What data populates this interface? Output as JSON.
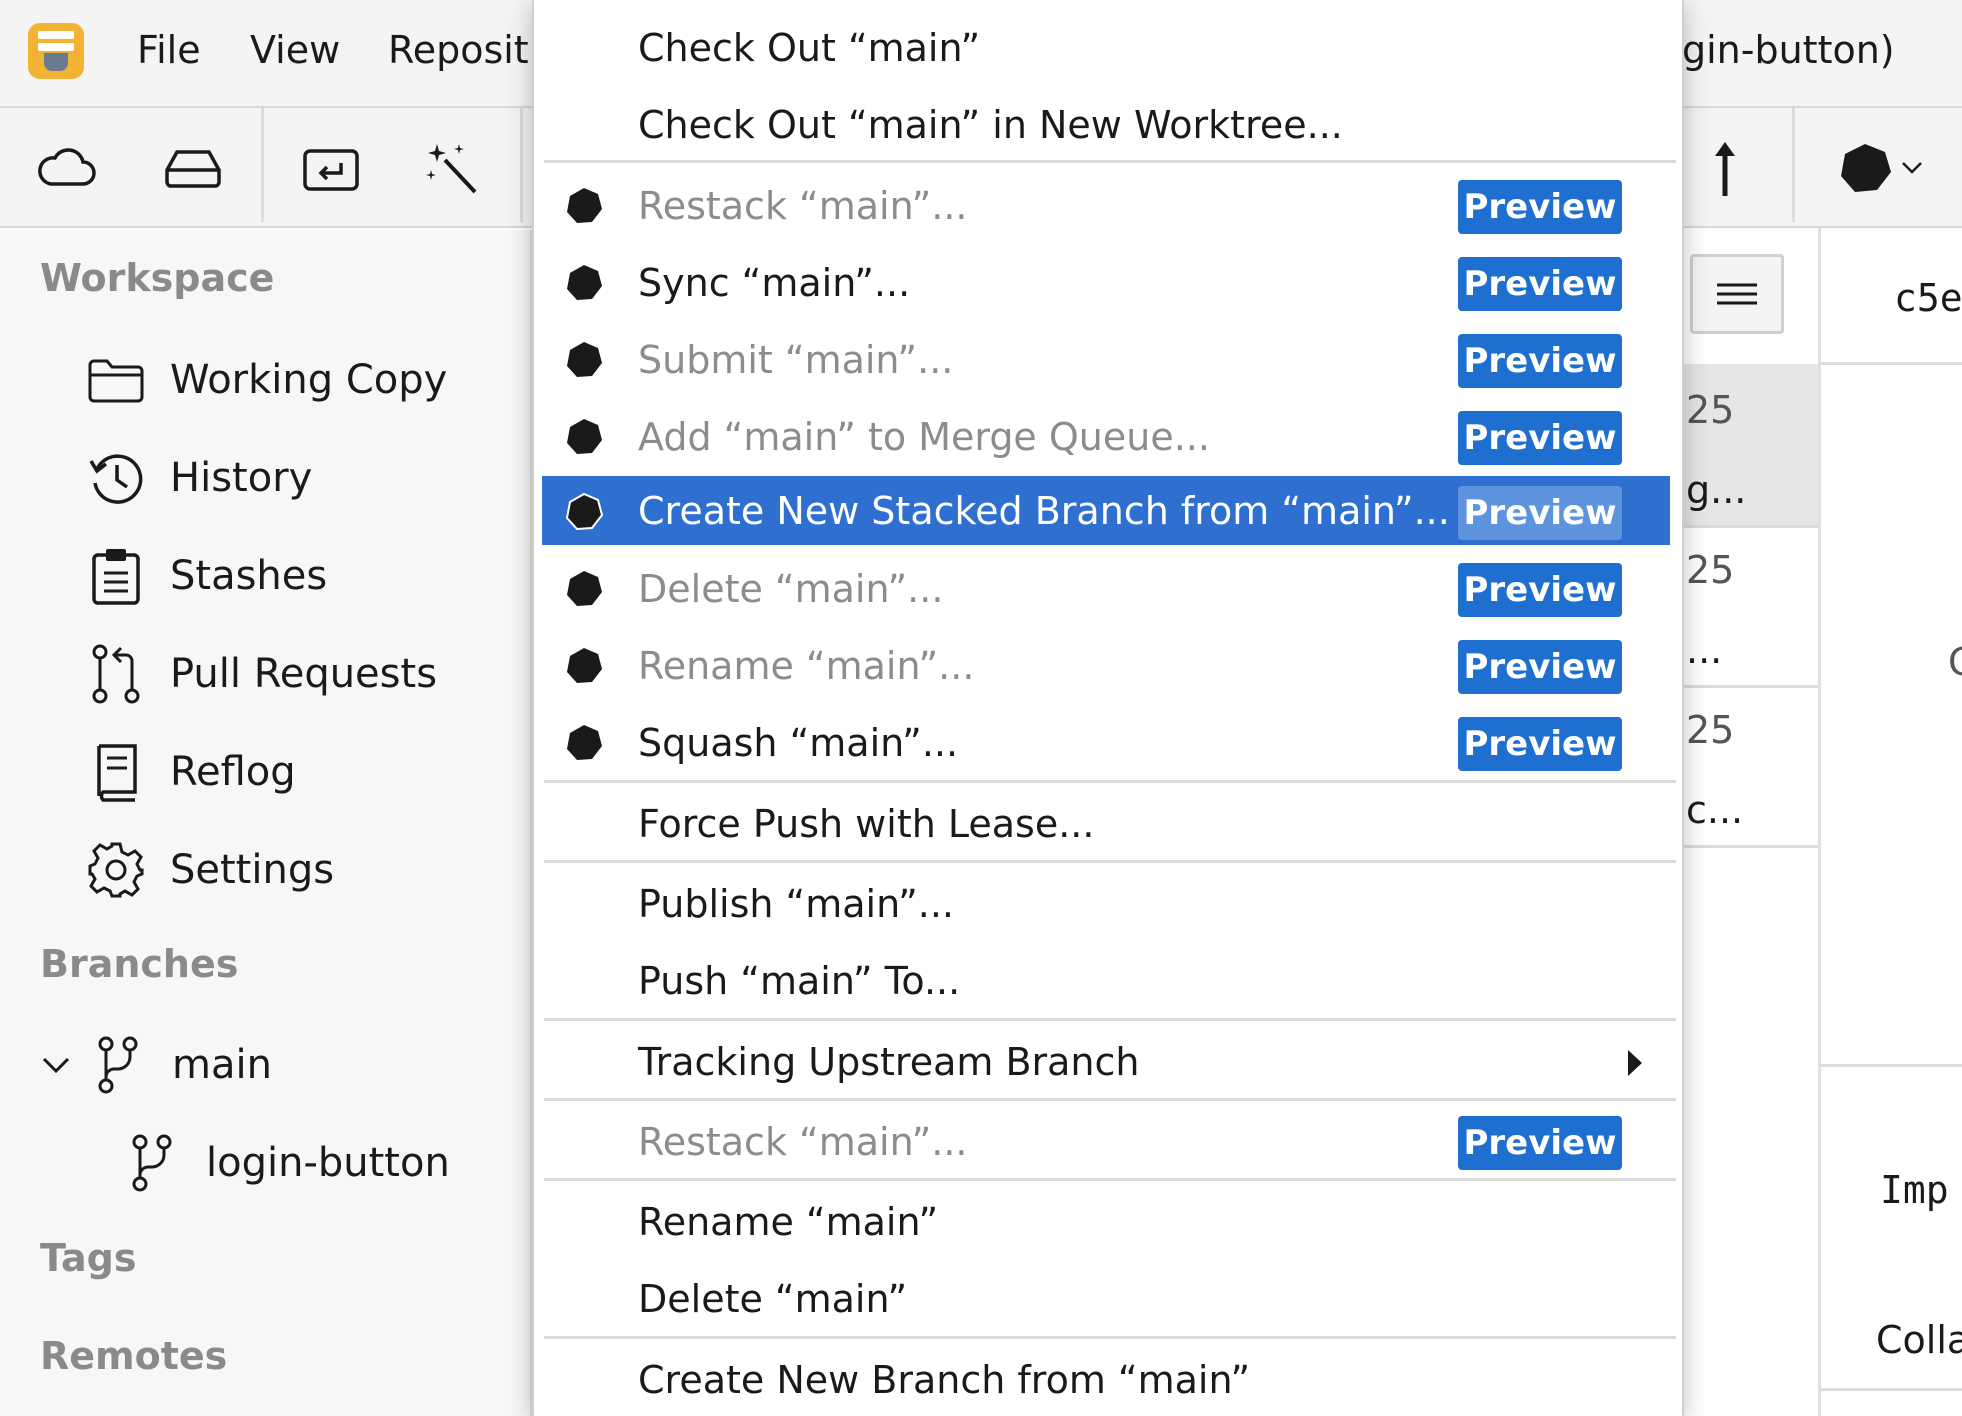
{
  "menubar": {
    "items": [
      "File",
      "View",
      "Reposit"
    ],
    "window_title_fragment": "gin-button)"
  },
  "sidebar": {
    "workspace_title": "Workspace",
    "workspace_items": [
      {
        "label": "Working Copy",
        "icon": "folder-icon"
      },
      {
        "label": "History",
        "icon": "history-icon"
      },
      {
        "label": "Stashes",
        "icon": "clipboard-icon"
      },
      {
        "label": "Pull Requests",
        "icon": "pull-request-icon"
      },
      {
        "label": "Reflog",
        "icon": "book-icon"
      },
      {
        "label": "Settings",
        "icon": "gear-icon"
      }
    ],
    "branches_title": "Branches",
    "branches": [
      {
        "label": "main",
        "icon": "branch-icon",
        "expanded": true
      },
      {
        "label": "login-button",
        "icon": "branch-icon"
      }
    ],
    "tags_title": "Tags",
    "remotes_title": "Remotes"
  },
  "background_pane": {
    "commit_hash_fragment": "c5e",
    "row_dates": [
      "25",
      "25",
      "25"
    ],
    "row_subjects": [
      "g...",
      "...",
      "c..."
    ],
    "detail_fragment_1": "Imp",
    "detail_fragment_2": "Colla",
    "edge_letter": "C"
  },
  "menu": {
    "badge_label": "Preview",
    "items": {
      "checkout": "Check Out “main”",
      "checkout_worktree": "Check Out  “main” in New Worktree...",
      "restack": "Restack “main”...",
      "sync": "Sync “main”...",
      "submit": "Submit “main”...",
      "merge_queue": "Add “main” to Merge Queue...",
      "stacked_branch": "Create New Stacked Branch from “main”...",
      "delete_preview": "Delete “main”...",
      "rename_preview": "Rename “main”...",
      "squash": "Squash “main”...",
      "force_push": "Force Push with Lease...",
      "publish": "Publish “main”...",
      "push_to": "Push “main” To...",
      "tracking": "Tracking Upstream Branch",
      "restack_2": "Restack “main”...",
      "rename": "Rename “main”",
      "delete": "Delete “main”",
      "create_branch": "Create New Branch from “main”"
    }
  },
  "colors": {
    "accent": "#2f6fd0",
    "badge": "#1e6fd0",
    "app_icon": "#f2b233"
  }
}
